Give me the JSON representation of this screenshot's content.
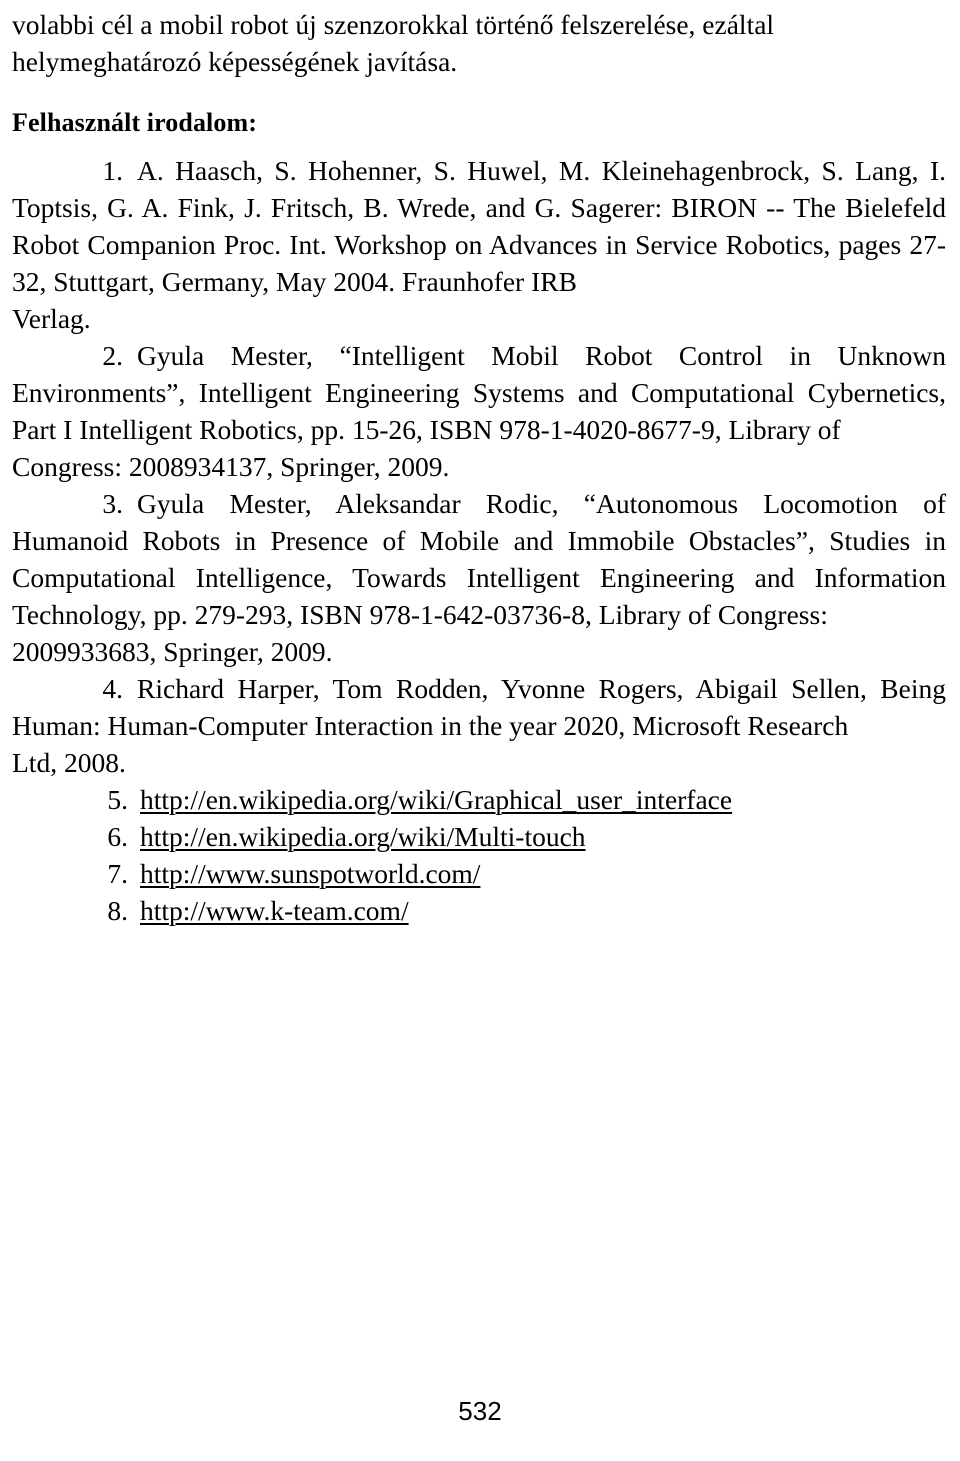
{
  "document": {
    "intro_paragraph": {
      "line1": "volabbi cél a mobil robot új szenzorokkal történő felszerelése, ezáltal",
      "line2": "helymeghatározó képességének javítása."
    },
    "references_heading": "Felhasznált irodalom:",
    "references": [
      {
        "number": "1.",
        "text": "A. Haasch, S. Hohenner, S. Huwel, M. Kleinehagenbrock, S. Lang, I. Toptsis, G. A. Fink, J. Fritsch, B. Wrede, and G. Sagerer: BIRON -- The Bielefeld Robot Companion Proc. Int. Workshop on Advances in Service Robotics, pages 27-32, Stuttgart, Germany, May 2004. Fraunhofer IRB",
        "last_line": "Verlag.",
        "is_link": false
      },
      {
        "number": "2.",
        "text": "Gyula Mester, “Intelligent Mobil Robot Control in Unknown Environments”, Intelligent Engineering Systems and Computational Cybernetics, Part I Intelligent Robotics, pp. 15-26, ISBN 978-1-4020-8677-9, Library of",
        "last_line": "Congress: 2008934137, Springer, 2009.",
        "is_link": false
      },
      {
        "number": "3.",
        "text": "Gyula Mester, Aleksandar Rodic, “Autonomous Locomotion of Humanoid Robots in Presence of Mobile and Immobile Obstacles”, Studies in Computational Intelligence, Towards Intelligent Engineering and Information Technology, pp. 279-293, ISBN 978-1-642-03736-8, Library of Congress:",
        "last_line": "2009933683, Springer, 2009.",
        "is_link": false
      },
      {
        "number": "4.",
        "text": "Richard Harper, Tom Rodden, Yvonne Rogers, Abigail Sellen, Being Human: Human-Computer Interaction in the year 2020, Microsoft Research",
        "last_line": "Ltd, 2008.",
        "is_link": false
      },
      {
        "number": "5.",
        "text": "http://en.wikipedia.org/wiki/Graphical_user_interface",
        "last_line": "",
        "is_link": true
      },
      {
        "number": "6.",
        "text": "http://en.wikipedia.org/wiki/Multi-touch",
        "last_line": "",
        "is_link": true
      },
      {
        "number": "7.",
        "text": "http://www.sunspotworld.com/",
        "last_line": "",
        "is_link": true
      },
      {
        "number": "8.",
        "text": "http://www.k-team.com/",
        "last_line": "",
        "is_link": true
      }
    ],
    "page_number": "532"
  }
}
